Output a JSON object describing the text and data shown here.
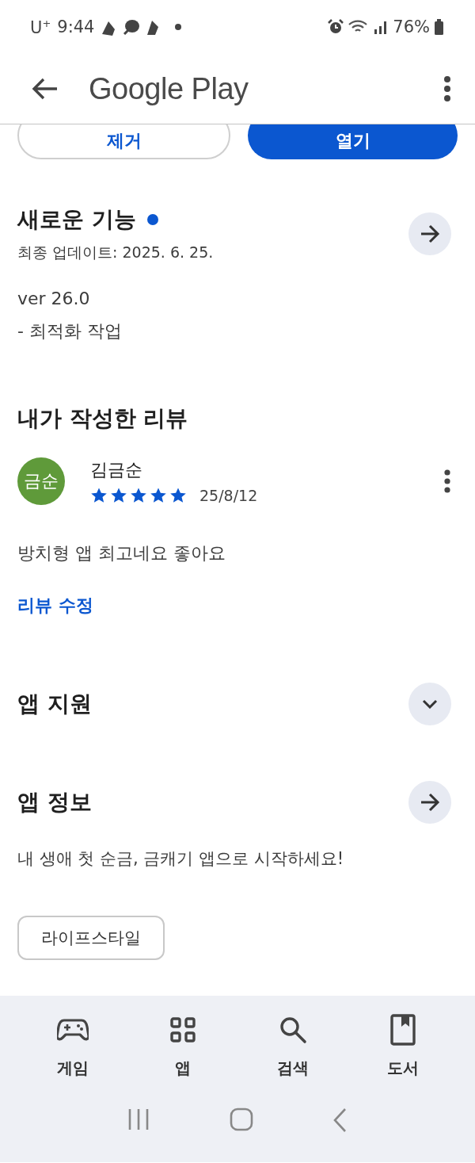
{
  "status_bar": {
    "carrier": "U$^{+}$",
    "time": "9:44",
    "battery": "76%"
  },
  "header": {
    "title": "Google Play"
  },
  "action_buttons": [
    {
      "label": "제거",
      "kind": "outlined"
    },
    {
      "label": "열기",
      "kind": "filled"
    }
  ],
  "whats_new": {
    "title": "새로운 기능",
    "new_indicator": true,
    "updated": "최종 업데이트: 2025. 6. 25.",
    "notes": [
      "ver 26.0",
      "- 최적화 작업"
    ]
  },
  "my_review": {
    "title": "내가 작성한 리뷰",
    "avatar_text": "금순",
    "author": "김금순",
    "stars": 5,
    "date": "25/8/12",
    "text": "방치형 앱 최고네요 좋아요",
    "edit_link": "리뷰 수정"
  },
  "app_support": {
    "title": "앱 지원",
    "expanded": false
  },
  "app_info": {
    "title": "앱 정보",
    "description": "내 생애 첫 순금, 금캐기 앱으로 시작하세요!",
    "tags": [
      "라이프스타일"
    ]
  },
  "bottom_nav": [
    {
      "label": "게임",
      "selected": false
    },
    {
      "label": "앱",
      "selected": false
    },
    {
      "label": "검색",
      "selected": false
    },
    {
      "label": "도서",
      "selected": false
    }
  ]
}
